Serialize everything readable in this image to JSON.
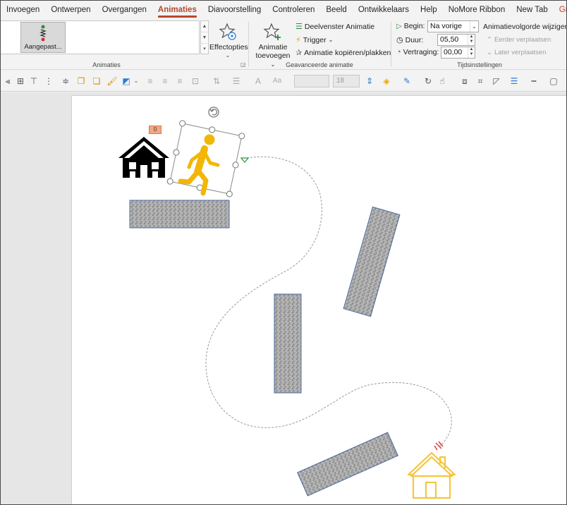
{
  "tabs": [
    "Invoegen",
    "Ontwerpen",
    "Overgangen",
    "Animaties",
    "Diavoorstelling",
    "Controleren",
    "Beeld",
    "Ontwikkelaars",
    "Help",
    "NoMore Ribbon",
    "New Tab",
    "Grafische indeling"
  ],
  "active_tab": "Animaties",
  "ribbon": {
    "animations_group": {
      "label": "Animaties",
      "selected_animation": "Aangepast...",
      "effect_options_label": "Effectopties"
    },
    "advanced_group": {
      "label": "Geavanceerde animatie",
      "add_animation_label_1": "Animatie",
      "add_animation_label_2": "toevoegen",
      "animation_pane": "Deelvenster Animatie",
      "trigger": "Trigger",
      "animation_painter": "Animatie kopiëren/plakken"
    },
    "timing_group": {
      "label": "Tijdsinstellingen",
      "start_label": "Begin:",
      "start_value": "Na vorige",
      "duration_label": "Duur:",
      "duration_value": "05,50",
      "delay_label": "Vertraging:",
      "delay_value": "00,00",
      "reorder_title": "Animatievolgorde wijzigen",
      "move_earlier": "Eerder verplaatsen",
      "move_later": "Later verplaatsen"
    }
  },
  "toolbar": {
    "font_size": "18"
  },
  "slide": {
    "animation_badge": "0",
    "colors": {
      "walker": "#f2b705",
      "start_house": "#000000",
      "end_house": "#f5c542",
      "path": "#9a9a9a",
      "block_border": "#4a6aa0"
    }
  },
  "colors": {
    "accent": "#b7472a",
    "context_tab": "#c43e1c"
  }
}
